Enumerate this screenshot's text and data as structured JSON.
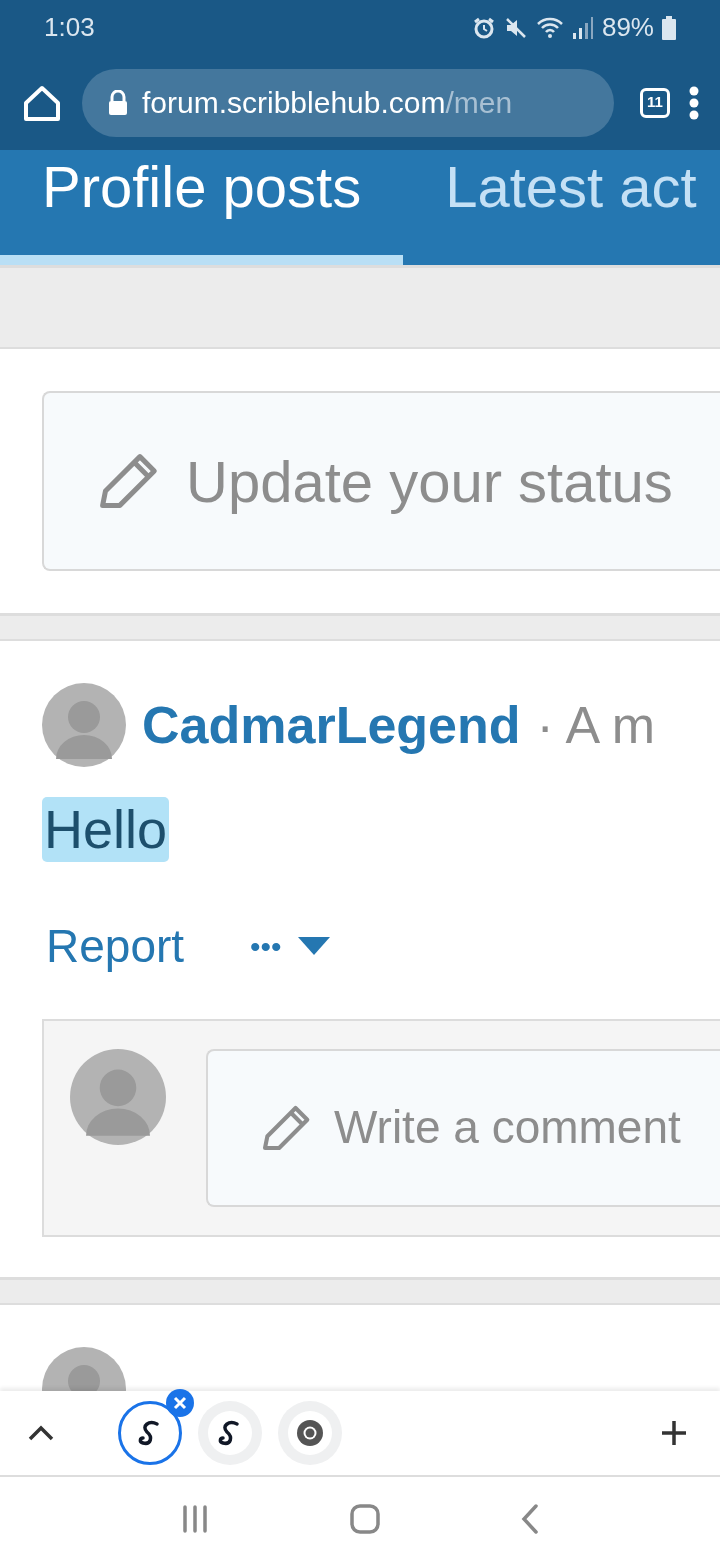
{
  "status_bar": {
    "time": "1:03",
    "battery": "89%"
  },
  "browser": {
    "url_host": "forum.scribblehub.com",
    "url_path": "/men",
    "tab_count": "11"
  },
  "tabs": [
    {
      "label": "Profile posts",
      "selected": true
    },
    {
      "label": "Latest act",
      "selected": false
    }
  ],
  "status_box": {
    "placeholder": "Update your status"
  },
  "posts": [
    {
      "kind": "full",
      "author": "CadmarLegend",
      "time": "· A m",
      "body": "Hello",
      "body_highlighted": true,
      "actions": [
        "Report",
        "•••"
      ],
      "comment_placeholder": "Write a comment"
    },
    {
      "kind": "partial"
    }
  ],
  "tab_strip": [
    {
      "kind": "site",
      "selected": true
    },
    {
      "kind": "site",
      "selected": false
    },
    {
      "kind": "browser",
      "selected": false
    }
  ]
}
